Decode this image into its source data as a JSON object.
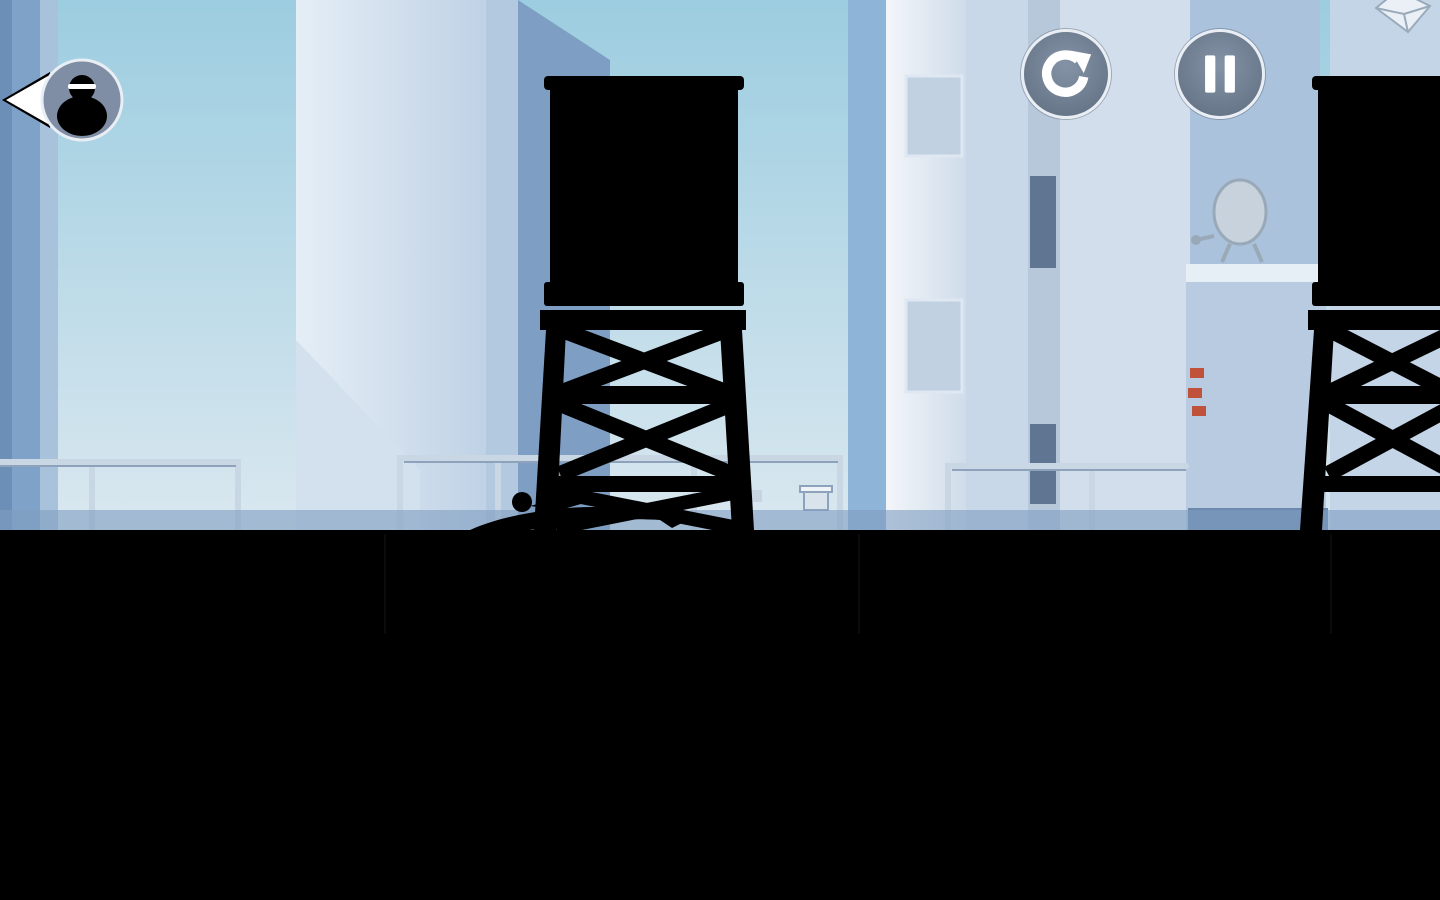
{
  "game": {
    "title": "",
    "scene": "rooftop-city-level"
  },
  "hud": {
    "restart_icon": "restart-icon",
    "pause_icon": "pause-icon",
    "offscreen_indicator_icon": "hunter-silhouette-icon",
    "collectible_icon": "crystal-gem-icon"
  },
  "colors": {
    "sky_top": "#9ccde0",
    "sky_bottom": "#d7e6ee",
    "building_light": "#c9d9ea",
    "building_mid": "#9fb7d3",
    "building_dark": "#6f8fb6",
    "silhouette": "#000000",
    "hud_button_fill": "#76849a",
    "hud_button_border": "#e9eef4",
    "brick_accent": "#c0513a"
  }
}
